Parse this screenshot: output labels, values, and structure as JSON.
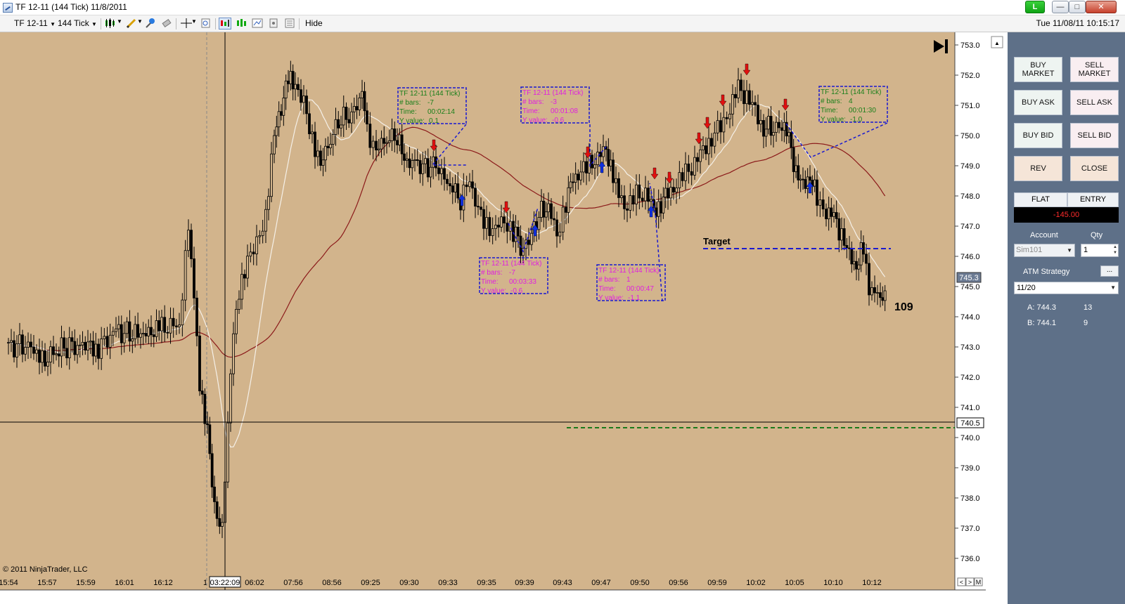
{
  "window": {
    "title": "TF 12-11 (144 Tick)  11/8/2011",
    "link_label": "L",
    "min_glyph": "—",
    "max_glyph": "□",
    "close_glyph": "✕"
  },
  "toolbar": {
    "instrument": "TF 12-11",
    "interval": "144 Tick",
    "hide_label": "Hide",
    "datetime": "Tue 11/08/11 10:15:17",
    "icons": [
      "candlestick-icon",
      "pencil-icon",
      "pin-icon",
      "eraser-icon",
      "crosshair-icon",
      "zoom-icon",
      "chart-trader-icon",
      "bar-style-icon",
      "data-box-icon",
      "properties-icon",
      "panel-icon"
    ]
  },
  "chart": {
    "copyright": "© 2011 NinjaTrader, LLC",
    "crosshair_time_label": "03:22:09",
    "crosshair_price_label": "740.5",
    "last_price_label": "745.3",
    "bar_timer": "109",
    "target_label": "Target",
    "price_ticks": [
      "753.0",
      "752.0",
      "751.0",
      "750.0",
      "749.0",
      "748.0",
      "747.0",
      "746.0",
      "745.0",
      "744.0",
      "743.0",
      "742.0",
      "741.0",
      "740.0",
      "739.0",
      "738.0",
      "737.0",
      "736.0"
    ],
    "time_ticks": [
      "15:54",
      "15:57",
      "15:59",
      "16:01",
      "16:12",
      "1",
      "06:02",
      "07:56",
      "08:56",
      "09:25",
      "09:30",
      "09:33",
      "09:35",
      "09:39",
      "09:43",
      "09:47",
      "09:50",
      "09:56",
      "09:59",
      "10:02",
      "10:05",
      "10:10",
      "10:12"
    ],
    "scroll_glyphs": [
      "<",
      ">",
      "M"
    ],
    "measure_boxes": [
      {
        "title": "TF 12-11 (144 Tick)",
        "bars_label": "# bars:",
        "bars": "-7",
        "time_label": "Time:",
        "time": "00:02:14",
        "y_label": "Y value:",
        "y": "0.1",
        "color": "#1a7f1a"
      },
      {
        "title": "TF 12-11 (144 Tick)",
        "bars_label": "# bars:",
        "bars": "-3",
        "time_label": "Time:",
        "time": "00:01:08",
        "y_label": "Y value:",
        "y": "-0.6",
        "color": "#e01ee0"
      },
      {
        "title": "TF 12-11 (144 Tick)",
        "bars_label": "# bars:",
        "bars": "-7",
        "time_label": "Time:",
        "time": "00:03:33",
        "y_label": "Y value:",
        "y": "-0.6",
        "color": "#e01ee0"
      },
      {
        "title": "TF 12-11 (144 Tick)",
        "bars_label": "# bars:",
        "bars": "1",
        "time_label": "Time:",
        "time": "00:00:47",
        "y_label": "Y value:",
        "y": "-1.1",
        "color": "#e01ee0"
      },
      {
        "title": "TF 12-11 (144 Tick)",
        "bars_label": "# bars:",
        "bars": "4",
        "time_label": "Time:",
        "time": "00:01:30",
        "y_label": "Y value:",
        "y": "-1.0",
        "color": "#1a7f1a"
      }
    ],
    "colors": {
      "background": "#d2b48c",
      "sma_fast": "#f5f0e8",
      "sma_slow": "#8b1a1a",
      "arrow_up": "#1030e0",
      "arrow_down": "#e01010",
      "target_line": "#1a1ad0",
      "stop_line": "#1a7a1a"
    }
  },
  "trader": {
    "buy_market": "BUY MARKET",
    "sell_market": "SELL MARKET",
    "buy_ask": "BUY ASK",
    "sell_ask": "SELL ASK",
    "buy_bid": "BUY BID",
    "sell_bid": "SELL BID",
    "rev": "REV",
    "close": "CLOSE",
    "flat": "FLAT",
    "entry": "ENTRY",
    "pnl": "-145.00",
    "account_label": "Account",
    "qty_label": "Qty",
    "account_value": "Sim101",
    "qty_value": "1",
    "atm_label": "ATM Strategy",
    "atm_button": "...",
    "atm_value": "11/20",
    "ask_label": "A: 744.3",
    "ask_size": "13",
    "bid_label": "B: 744.1",
    "bid_size": "9"
  }
}
